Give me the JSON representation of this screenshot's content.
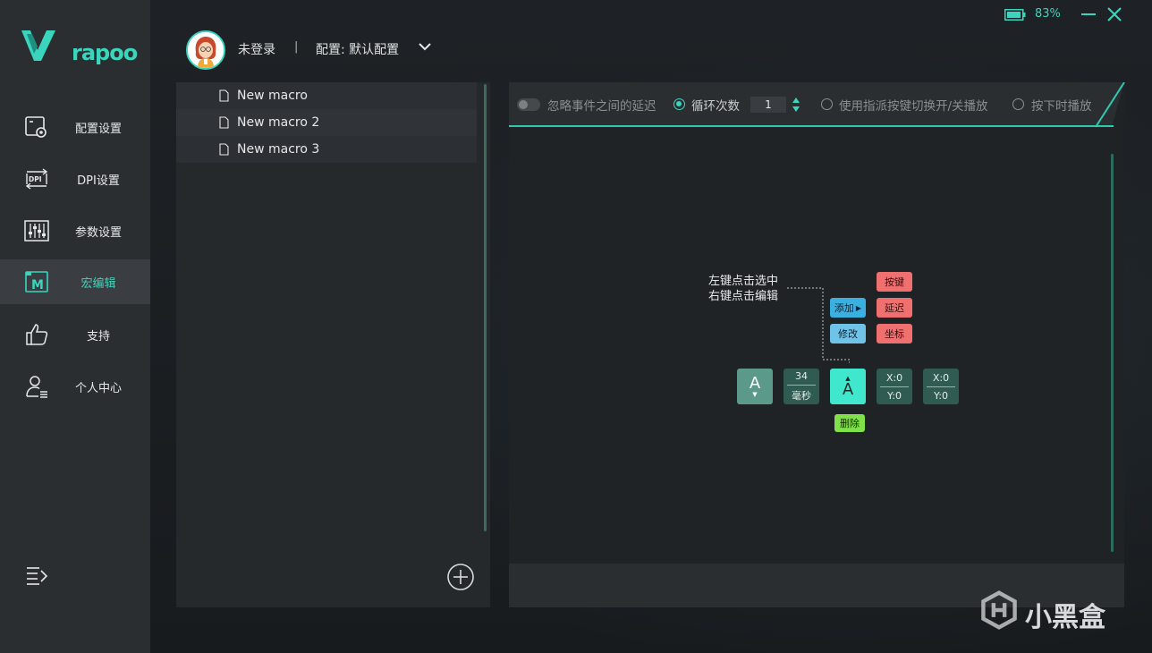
{
  "app": {
    "brand": "rapoo"
  },
  "header": {
    "username": "未登录",
    "separator": "|",
    "profile": "配置: 默认配置",
    "battery": "83%"
  },
  "sidebar": {
    "items": [
      {
        "label": "配置设置",
        "icon": "config-icon"
      },
      {
        "label": "DPI设置",
        "icon": "dpi-icon"
      },
      {
        "label": "参数设置",
        "icon": "sliders-icon"
      },
      {
        "label": "宏编辑",
        "icon": "macro-icon",
        "active": true
      },
      {
        "label": "支持",
        "icon": "thumbs-up-icon"
      },
      {
        "label": "个人中心",
        "icon": "user-icon"
      }
    ]
  },
  "macros": [
    {
      "name": "New macro"
    },
    {
      "name": "New macro 2"
    },
    {
      "name": "New macro 3"
    }
  ],
  "toolbar": {
    "ignore_delay": "忽略事件之间的延迟",
    "loop_count": "循环次数",
    "loop_value": "1",
    "toggle_by_key": "使用指派按键切换开/关播放",
    "play_while_pressed": "按下时播放"
  },
  "tutorial": {
    "hint_line1": "左键点击选中",
    "hint_line2": "右键点击编辑",
    "add": "添加",
    "modify": "修改",
    "key": "按键",
    "delay": "延迟",
    "coord": "坐标",
    "delete": "删除",
    "node_key_1": "A",
    "node_key_2": "A",
    "delay_value": "34",
    "delay_unit": "毫秒",
    "xy1_x": "X:0",
    "xy1_y": "Y:0",
    "xy2_x": "X:0",
    "xy2_y": "Y:0"
  },
  "watermark": "小黑盒",
  "colors": {
    "accent": "#39d6bd",
    "delete": "#7fe04a",
    "red": "#f07070",
    "blue": "#3ab0e0"
  }
}
